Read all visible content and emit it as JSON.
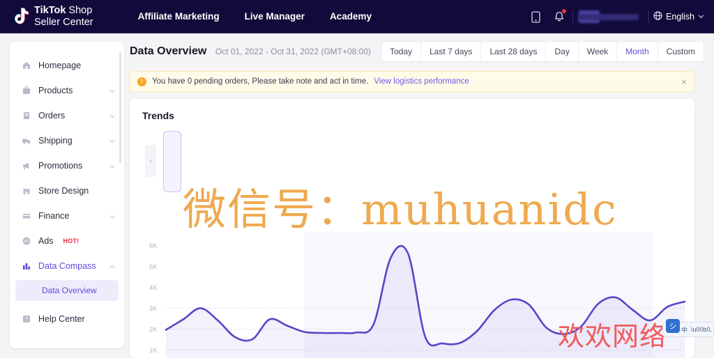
{
  "header": {
    "logo_line1_bold": "TikTok",
    "logo_line1_light": " Shop",
    "logo_line2": "Seller Center",
    "nav": [
      {
        "label": "Affiliate Marketing"
      },
      {
        "label": "Live Manager"
      },
      {
        "label": "Academy"
      }
    ],
    "icons": {
      "mobile": "mobile-app-icon",
      "bell": "notification-bell-icon",
      "globe": "globe-icon",
      "chevron": "chevron-down-icon"
    },
    "language": "English",
    "brand_bg": "#120a3a"
  },
  "sidebar": {
    "items": [
      {
        "label": "Homepage",
        "icon": "home-icon",
        "expandable": false
      },
      {
        "label": "Products",
        "icon": "box-icon",
        "expandable": true
      },
      {
        "label": "Orders",
        "icon": "order-list-icon",
        "expandable": true
      },
      {
        "label": "Shipping",
        "icon": "truck-icon",
        "expandable": true
      },
      {
        "label": "Promotions",
        "icon": "megaphone-icon",
        "expandable": true
      },
      {
        "label": "Store Design",
        "icon": "storefront-icon",
        "expandable": false
      },
      {
        "label": "Finance",
        "icon": "card-icon",
        "expandable": true
      },
      {
        "label": "Ads",
        "icon": "ads-icon",
        "expandable": false,
        "badge": "HOT!"
      },
      {
        "label": "Data Compass",
        "icon": "bar-chart-icon",
        "expandable": true,
        "expanded": true,
        "active": true
      },
      {
        "label": "Help Center",
        "icon": "help-icon",
        "expandable": false
      }
    ],
    "subitem": {
      "label": "Data Overview",
      "active": true
    },
    "active_color": "#5c4ddb"
  },
  "main": {
    "page_title": "Data Overview",
    "date_range": "Oct 01, 2022 - Oct 31, 2022 (GMT+08:00)",
    "range_tabs": [
      {
        "label": "Today",
        "selected": false
      },
      {
        "label": "Last 7 days",
        "selected": false
      },
      {
        "label": "Last 28 days",
        "selected": false
      },
      {
        "label": "Day",
        "selected": false
      },
      {
        "label": "Week",
        "selected": false
      },
      {
        "label": "Month",
        "selected": true
      },
      {
        "label": "Custom",
        "selected": false
      }
    ],
    "alert": {
      "icon": "warning-icon",
      "text": "You have 0 pending orders, Please take note and act in time.",
      "link": "View logistics performance",
      "close": "×",
      "bg": "#fffbe9",
      "border": "#fce9b0"
    },
    "card": {
      "title": "Trends",
      "scroll_left": "‹"
    }
  },
  "watermarks": {
    "orange": "微信号：muhuanidc",
    "orange_color": "#efa94f",
    "red": "欢欢网络",
    "red_color": "#ef5b5b",
    "ime_glyph": "中"
  },
  "chart_data": {
    "type": "area",
    "title": "Trends",
    "xlabel": "",
    "ylabel": "",
    "ylim": [
      0,
      6500
    ],
    "grid": true,
    "legend": null,
    "ytick_labels": [
      "6K",
      "5K",
      "4K",
      "3K",
      "2K",
      "1K"
    ],
    "ytick_values": [
      6000,
      5000,
      4000,
      3000,
      2000,
      1000
    ],
    "line_color": "#5546c8",
    "fill_color": "rgba(92,77,219,0.08)",
    "series": [
      {
        "name": "Trend",
        "values": [
          1950,
          2450,
          2980,
          2400,
          1600,
          1500,
          2450,
          2150,
          1850,
          1800,
          1800,
          1820,
          2200,
          5400,
          5600,
          1600,
          1300,
          1320,
          1900,
          2900,
          3400,
          3150,
          2050,
          1750,
          2100,
          3200,
          3500,
          2900,
          2400,
          3050,
          3300
        ]
      }
    ],
    "x": [
      "1",
      "2",
      "3",
      "4",
      "5",
      "6",
      "7",
      "8",
      "9",
      "10",
      "11",
      "12",
      "13",
      "14",
      "15",
      "16",
      "17",
      "18",
      "19",
      "20",
      "21",
      "22",
      "23",
      "24",
      "25",
      "26",
      "27",
      "28",
      "29",
      "30",
      "31"
    ],
    "highlight_band": {
      "from_index": 7,
      "to_index": 23
    }
  }
}
